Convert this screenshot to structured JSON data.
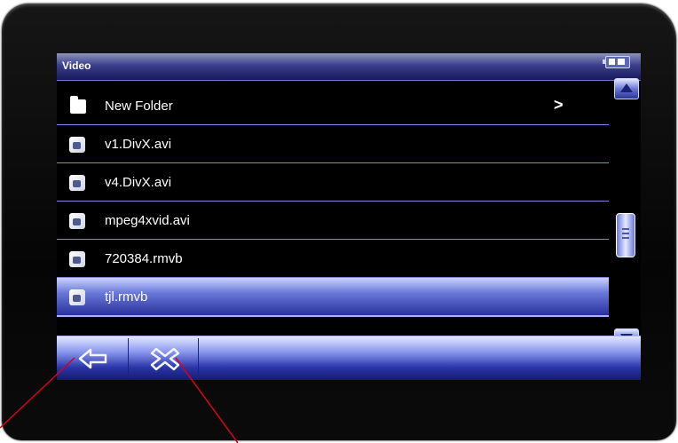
{
  "title_bar": {
    "title": "Video",
    "battery_icon": "battery-icon"
  },
  "file_list": [
    {
      "name": "New Folder",
      "type": "folder",
      "has_arrow": true,
      "arrow": ">"
    },
    {
      "name": "v1.DivX.avi",
      "type": "video"
    },
    {
      "name": "v4.DivX.avi",
      "type": "video"
    },
    {
      "name": "mpeg4xvid.avi",
      "type": "video"
    },
    {
      "name": "720384.rmvb",
      "type": "video"
    },
    {
      "name": "tjl.rmvb",
      "type": "video",
      "selected": true
    }
  ],
  "scrollbar": {
    "up_icon": "triangle-up-icon",
    "down_icon": "triangle-down-icon",
    "position": 0.6
  },
  "bottom_bar": {
    "back_icon": "back-arrow-icon",
    "close_icon": "close-x-icon"
  },
  "colors": {
    "accent": "#3b45b5",
    "selected": "#6a79d9",
    "divider": "#7b86e6",
    "pointer_line": "#d6001c"
  }
}
